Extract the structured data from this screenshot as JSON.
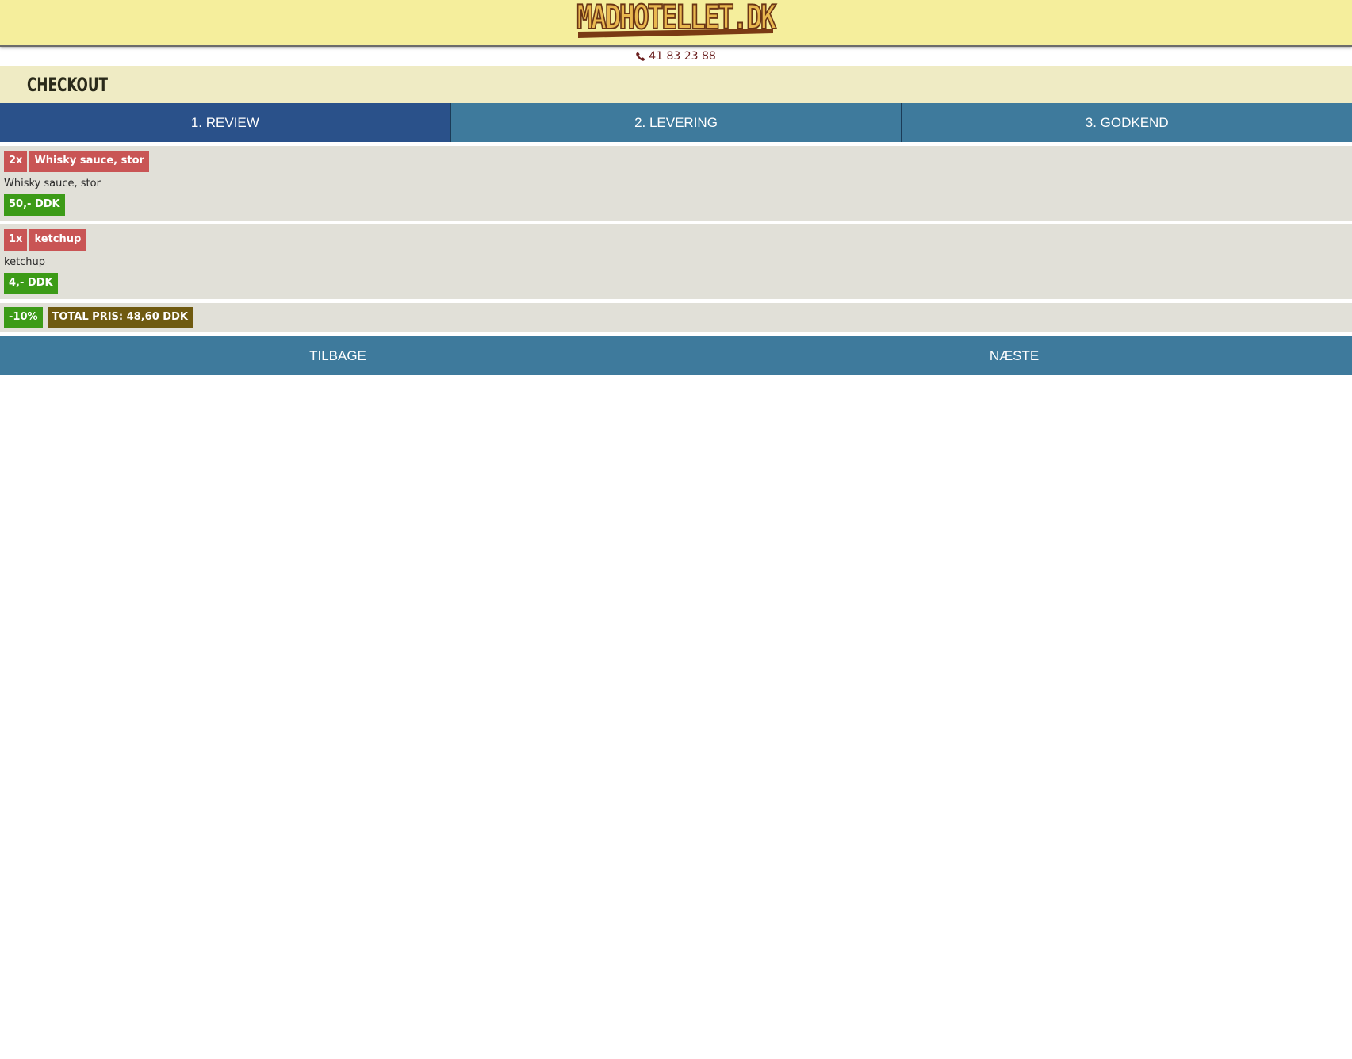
{
  "header": {
    "logo_text": "MADHOTELLET.DK",
    "phone": "41 83 23 88"
  },
  "page": {
    "title": "CHECKOUT"
  },
  "steps": [
    {
      "label": "1. REVIEW",
      "active": true
    },
    {
      "label": "2. LEVERING",
      "active": false
    },
    {
      "label": "3. GODKEND",
      "active": false
    }
  ],
  "items": [
    {
      "qty": "2x",
      "name": "Whisky sauce, stor",
      "description": "Whisky sauce, stor",
      "price": "50,- DDK"
    },
    {
      "qty": "1x",
      "name": "ketchup",
      "description": "ketchup",
      "price": "4,- DDK"
    }
  ],
  "summary": {
    "discount": "-10%",
    "total": "TOTAL PRIS: 48,60 DDK"
  },
  "nav": {
    "back_label": "TILBAGE",
    "next_label": "NÆSTE"
  },
  "colors": {
    "header_bg": "#f5ee9c",
    "title_bg": "#efebc4",
    "step_active": "#2a518a",
    "step_inactive": "#3e7a9c",
    "item_bg": "#e1e0d8",
    "badge_red": "#c95555",
    "badge_green": "#3c9b17",
    "badge_olive": "#6f5a10"
  },
  "icons": {
    "phone": "phone-icon"
  }
}
